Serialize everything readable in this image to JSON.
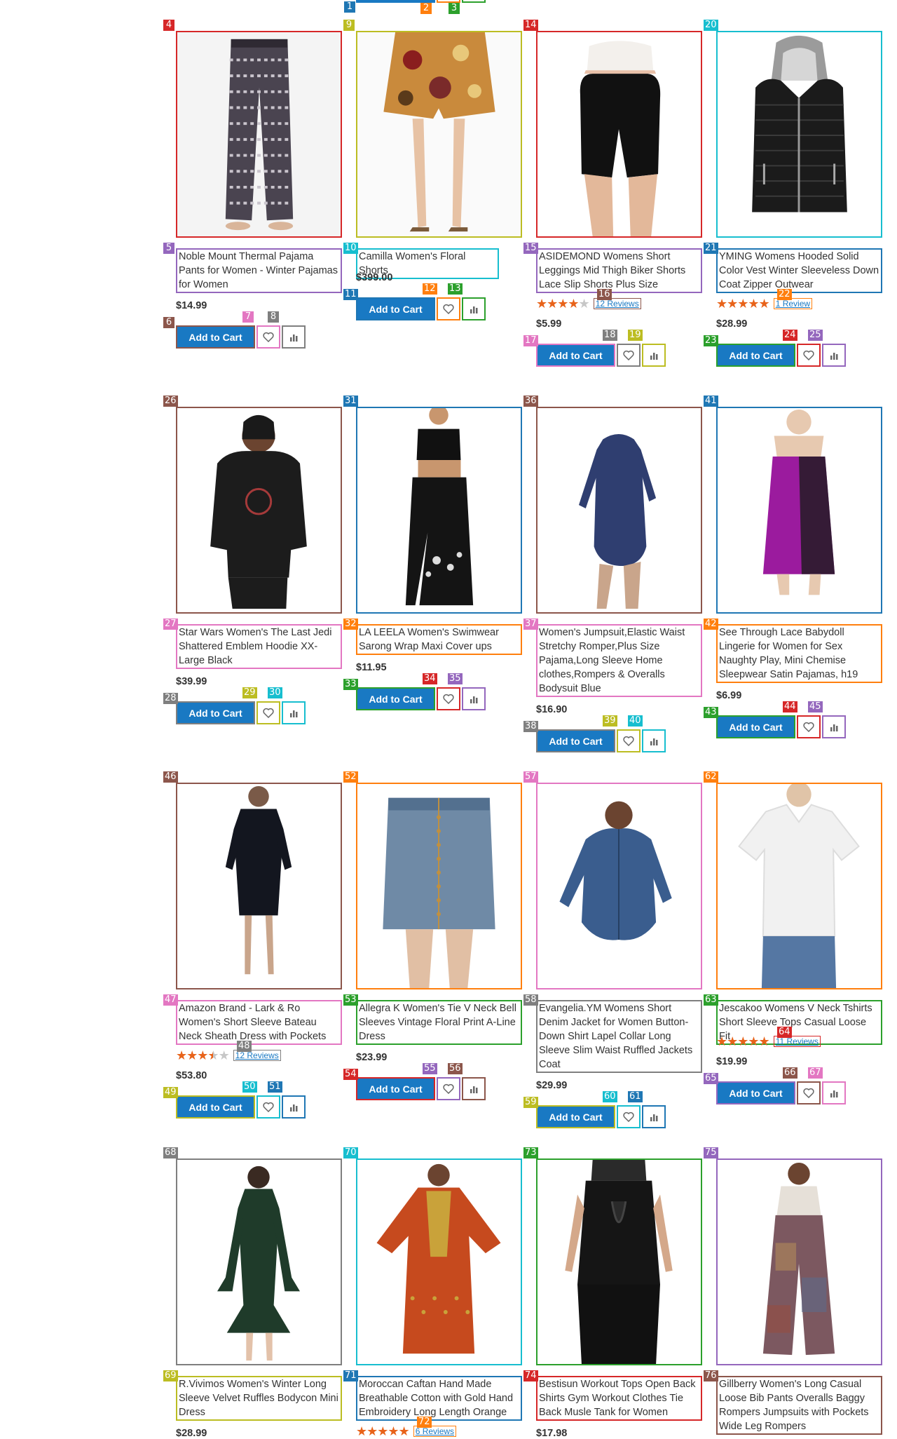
{
  "products": [
    {
      "name": "Noble Mount Thermal Pajama Pants for Women - Winter Pajamas for Women",
      "price": "$14.99",
      "icon": "pajama-pants-image",
      "tags": [
        "4",
        "5",
        "6",
        "7",
        "8"
      ],
      "colors": [
        "#d62728",
        "#9467bd",
        "#8c564b",
        "#e377c2",
        "#7f7f7f"
      ]
    },
    {
      "name": "Camilla Women's Floral Shorts",
      "price": "$399.00",
      "icon": "floral-shorts-image",
      "tags": [
        "9",
        "10",
        "11",
        "12",
        "13"
      ],
      "colors": [
        "#bcbd22",
        "#17becf",
        "#1f77b4",
        "#ff7f0e",
        "#2ca02c"
      ]
    },
    {
      "name": "ASIDEMOND Womens Short Leggings Mid Thigh Biker Shorts Lace Slip Shorts Plus Size",
      "price": "$5.99",
      "icon": "biker-shorts-image",
      "rating": 4,
      "reviews": "12  Reviews",
      "tags": [
        "14",
        "15",
        "16",
        "17",
        "18",
        "19"
      ],
      "colors": [
        "#d62728",
        "#9467bd",
        "#8c564b",
        "#e377c2",
        "#7f7f7f",
        "#bcbd22"
      ]
    },
    {
      "name": "YMING Womens Hooded Solid Color Vest Winter Sleeveless Down Coat Zipper Outwear",
      "price": "$28.99",
      "icon": "hooded-vest-image",
      "rating": 5,
      "reviews": "1  Review",
      "tags": [
        "20",
        "21",
        "22",
        "23",
        "24",
        "25"
      ],
      "colors": [
        "#17becf",
        "#1f77b4",
        "#ff7f0e",
        "#2ca02c",
        "#d62728",
        "#9467bd"
      ]
    },
    {
      "name": "Star Wars Women's The Last Jedi Shattered Emblem Hoodie XX-Large Black",
      "price": "$39.99",
      "icon": "hoodie-image",
      "tags": [
        "26",
        "27",
        "28",
        "29",
        "30"
      ],
      "colors": [
        "#8c564b",
        "#e377c2",
        "#7f7f7f",
        "#bcbd22",
        "#17becf"
      ]
    },
    {
      "name": "LA LEELA Women's Swimwear Sarong Wrap Maxi Cover ups",
      "price": "$11.95",
      "icon": "sarong-image",
      "tags": [
        "31",
        "32",
        "33",
        "34",
        "35"
      ],
      "colors": [
        "#1f77b4",
        "#ff7f0e",
        "#2ca02c",
        "#d62728",
        "#9467bd"
      ]
    },
    {
      "name": "Women's Jumpsuit,Elastic Waist Stretchy Romper,Plus Size Pajama,Long Sleeve Home clothes,Rompers & Overalls Bodysuit Blue",
      "price": "$16.90",
      "icon": "romper-image",
      "tags": [
        "36",
        "37",
        "38",
        "39",
        "40"
      ],
      "colors": [
        "#8c564b",
        "#e377c2",
        "#7f7f7f",
        "#bcbd22",
        "#17becf"
      ]
    },
    {
      "name": "See Through Lace Babydoll Lingerie for Women for Sex Naughty Play, Mini Chemise Sleepwear Satin Pajamas, h19",
      "price": "$6.99",
      "icon": "babydoll-image",
      "tags": [
        "41",
        "42",
        "43",
        "44",
        "45"
      ],
      "colors": [
        "#1f77b4",
        "#ff7f0e",
        "#2ca02c",
        "#d62728",
        "#9467bd"
      ]
    },
    {
      "name": "Amazon Brand - Lark & Ro Women's Short Sleeve Bateau Neck Sheath Dress with Pockets",
      "price": "$53.80",
      "icon": "sheath-dress-image",
      "rating": 3.5,
      "reviews": "12  Reviews",
      "tags": [
        "46",
        "47",
        "48",
        "49",
        "50",
        "51"
      ],
      "colors": [
        "#8c564b",
        "#e377c2",
        "#7f7f7f",
        "#bcbd22",
        "#17becf",
        "#1f77b4"
      ]
    },
    {
      "name": "Allegra K Women's Tie V Neck Bell Sleeves Vintage Floral Print A-Line Dress",
      "price": "$23.99",
      "icon": "denim-skirt-image",
      "tags": [
        "52",
        "53",
        "54",
        "55",
        "56"
      ],
      "colors": [
        "#ff7f0e",
        "#2ca02c",
        "#d62728",
        "#9467bd",
        "#8c564b"
      ]
    },
    {
      "name": "Evangelia.YM Womens Short Denim Jacket for Women Button-Down Shirt Lapel Collar Long Sleeve Slim Waist Ruffled Jackets Coat",
      "price": "$29.99",
      "icon": "denim-jacket-image",
      "tags": [
        "57",
        "58",
        "59",
        "60",
        "61"
      ],
      "colors": [
        "#e377c2",
        "#7f7f7f",
        "#bcbd22",
        "#17becf",
        "#1f77b4"
      ]
    },
    {
      "name": "Jescakoo Womens V Neck Tshirts Short Sleeve Tops Casual Loose Fit",
      "price": "$19.99",
      "icon": "tshirt-image",
      "rating": 5,
      "reviews": "11  Reviews",
      "tags": [
        "62",
        "63",
        "64",
        "65",
        "66",
        "67"
      ],
      "colors": [
        "#ff7f0e",
        "#2ca02c",
        "#d62728",
        "#9467bd",
        "#8c564b",
        "#e377c2"
      ]
    },
    {
      "name": "R.Vivimos Women's Winter Long Sleeve Velvet Ruffles Bodycon Mini Dress",
      "price": "$28.99",
      "icon": "velvet-dress-image",
      "tags": [
        "68",
        "69"
      ],
      "colors": [
        "#7f7f7f",
        "#bcbd22"
      ]
    },
    {
      "name": "Moroccan Caftan Hand Made Breathable Cotton with Gold Hand Embroidery Long Length Orange",
      "price": "",
      "icon": "caftan-image",
      "rating": 5,
      "reviews": "6  Reviews",
      "tags": [
        "70",
        "71",
        "72"
      ],
      "colors": [
        "#17becf",
        "#1f77b4",
        "#ff7f0e"
      ]
    },
    {
      "name": "Bestisun Workout Tops Open Back Shirts Gym Workout Clothes Tie Back Musle Tank for Women",
      "price": "$17.98",
      "icon": "workout-top-image",
      "tags": [
        "73",
        "74"
      ],
      "colors": [
        "#2ca02c",
        "#d62728"
      ]
    },
    {
      "name": "Gillberry Women's Long Casual Loose Bib Pants Overalls Baggy Rompers Jumpsuits with Pockets Wide Leg Rompers",
      "price": "",
      "icon": "overalls-image",
      "tags": [
        "75",
        "76"
      ],
      "colors": [
        "#9467bd",
        "#8c564b"
      ]
    }
  ],
  "top_tags": {
    "tags": [
      "1",
      "2",
      "3"
    ],
    "colors": [
      "#1f77b4",
      "#ff7f0e",
      "#2ca02c"
    ]
  },
  "add_to_cart_label": "Add to Cart",
  "star_color": "#e8631a",
  "button_color": "#1979c3"
}
